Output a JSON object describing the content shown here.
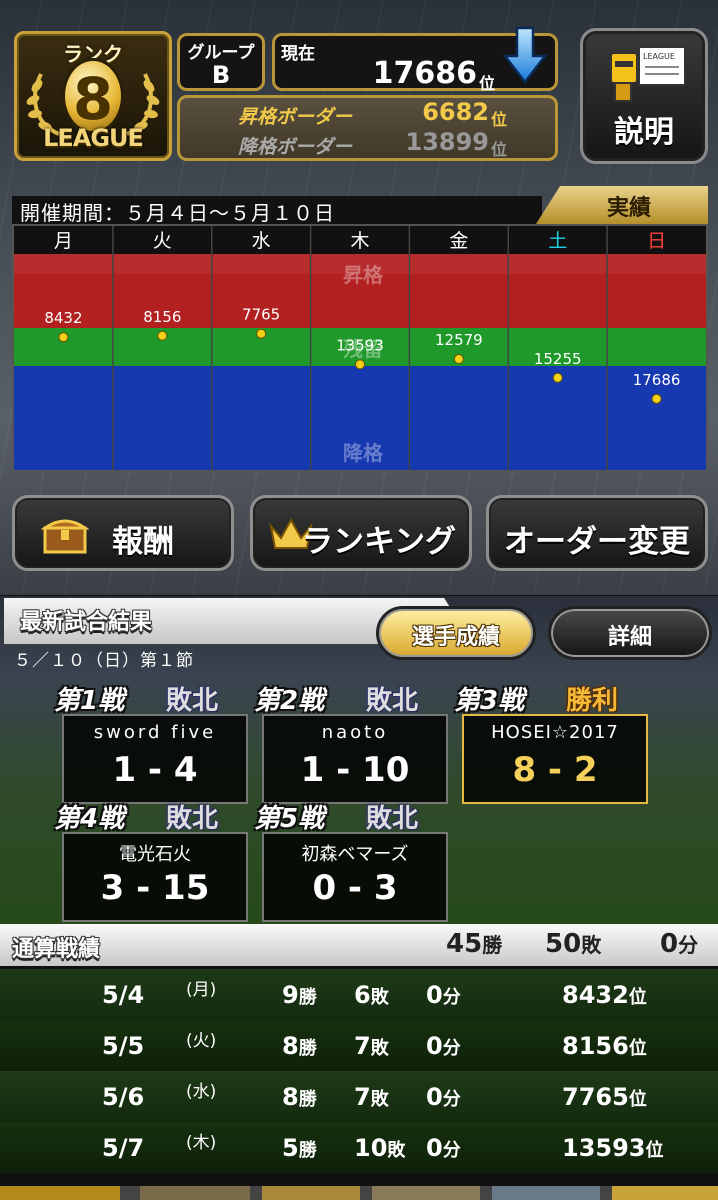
{
  "rank": {
    "label": "ランク",
    "number": "8",
    "league": "LEAGUE"
  },
  "group": {
    "label": "グループ",
    "value": "B"
  },
  "current": {
    "label": "現在",
    "value": "17686",
    "unit": "位"
  },
  "borders": {
    "promotion_label": "昇格ボーダー",
    "promotion_value": "6682",
    "promotion_unit": "位",
    "demotion_label": "降格ボーダー",
    "demotion_value": "13899",
    "demotion_unit": "位"
  },
  "explain_button": {
    "icon_text": "LEAGUE",
    "label": "説明"
  },
  "period": "開催期間：５月４日～５月１０日",
  "results_tab": "実績",
  "chart_data": {
    "type": "line",
    "categories": [
      "月",
      "火",
      "水",
      "木",
      "金",
      "土",
      "日"
    ],
    "category_colors": [
      "#ffffff",
      "#ffffff",
      "#ffffff",
      "#ffffff",
      "#ffffff",
      "#22d0e6",
      "#ff4040"
    ],
    "values": [
      8432,
      8156,
      7765,
      13593,
      12579,
      15255,
      17686
    ],
    "zones": [
      {
        "label": "昇格",
        "color": "#b32020"
      },
      {
        "label": "残留",
        "color": "#1f9a2a"
      },
      {
        "label": "降格",
        "color": "#1638b0"
      }
    ],
    "point_color": "#f5d21a"
  },
  "buttons": {
    "reward": "報酬",
    "ranking": "ランキング",
    "order": "オーダー変更"
  },
  "latest": {
    "title": "最新試合結果",
    "subtitle": "５／１０（日）第１節",
    "player_stats_button": "選手成績",
    "detail_button": "詳細",
    "games": [
      {
        "no": "第1戦",
        "result": "敗北",
        "won": false,
        "opponent": "sword five",
        "score": "1 - 4"
      },
      {
        "no": "第2戦",
        "result": "敗北",
        "won": false,
        "opponent": "naoto",
        "score": "1 - 10"
      },
      {
        "no": "第3戦",
        "result": "勝利",
        "won": true,
        "opponent": "HOSEI☆2017",
        "score": "8 - 2"
      },
      {
        "no": "第4戦",
        "result": "敗北",
        "won": false,
        "opponent": "電光石火",
        "score": "3 - 15"
      },
      {
        "no": "第5戦",
        "result": "敗北",
        "won": false,
        "opponent": "初森ベマーズ",
        "score": "0 - 3"
      }
    ]
  },
  "summary": {
    "title": "通算戦績",
    "wins": "45",
    "wins_unit": "勝",
    "losses": "50",
    "losses_unit": "敗",
    "draws": "0",
    "draws_unit": "分",
    "rows": [
      {
        "date": "5/4",
        "dow": "(月)",
        "w": "9",
        "l": "6",
        "d": "0",
        "rank": "8432"
      },
      {
        "date": "5/5",
        "dow": "(火)",
        "w": "8",
        "l": "7",
        "d": "0",
        "rank": "8156"
      },
      {
        "date": "5/6",
        "dow": "(水)",
        "w": "8",
        "l": "7",
        "d": "0",
        "rank": "7765"
      },
      {
        "date": "5/7",
        "dow": "(木)",
        "w": "5",
        "l": "10",
        "d": "0",
        "rank": "13593"
      }
    ],
    "units": {
      "w": "勝",
      "l": "敗",
      "d": "分",
      "rank": "位"
    }
  }
}
